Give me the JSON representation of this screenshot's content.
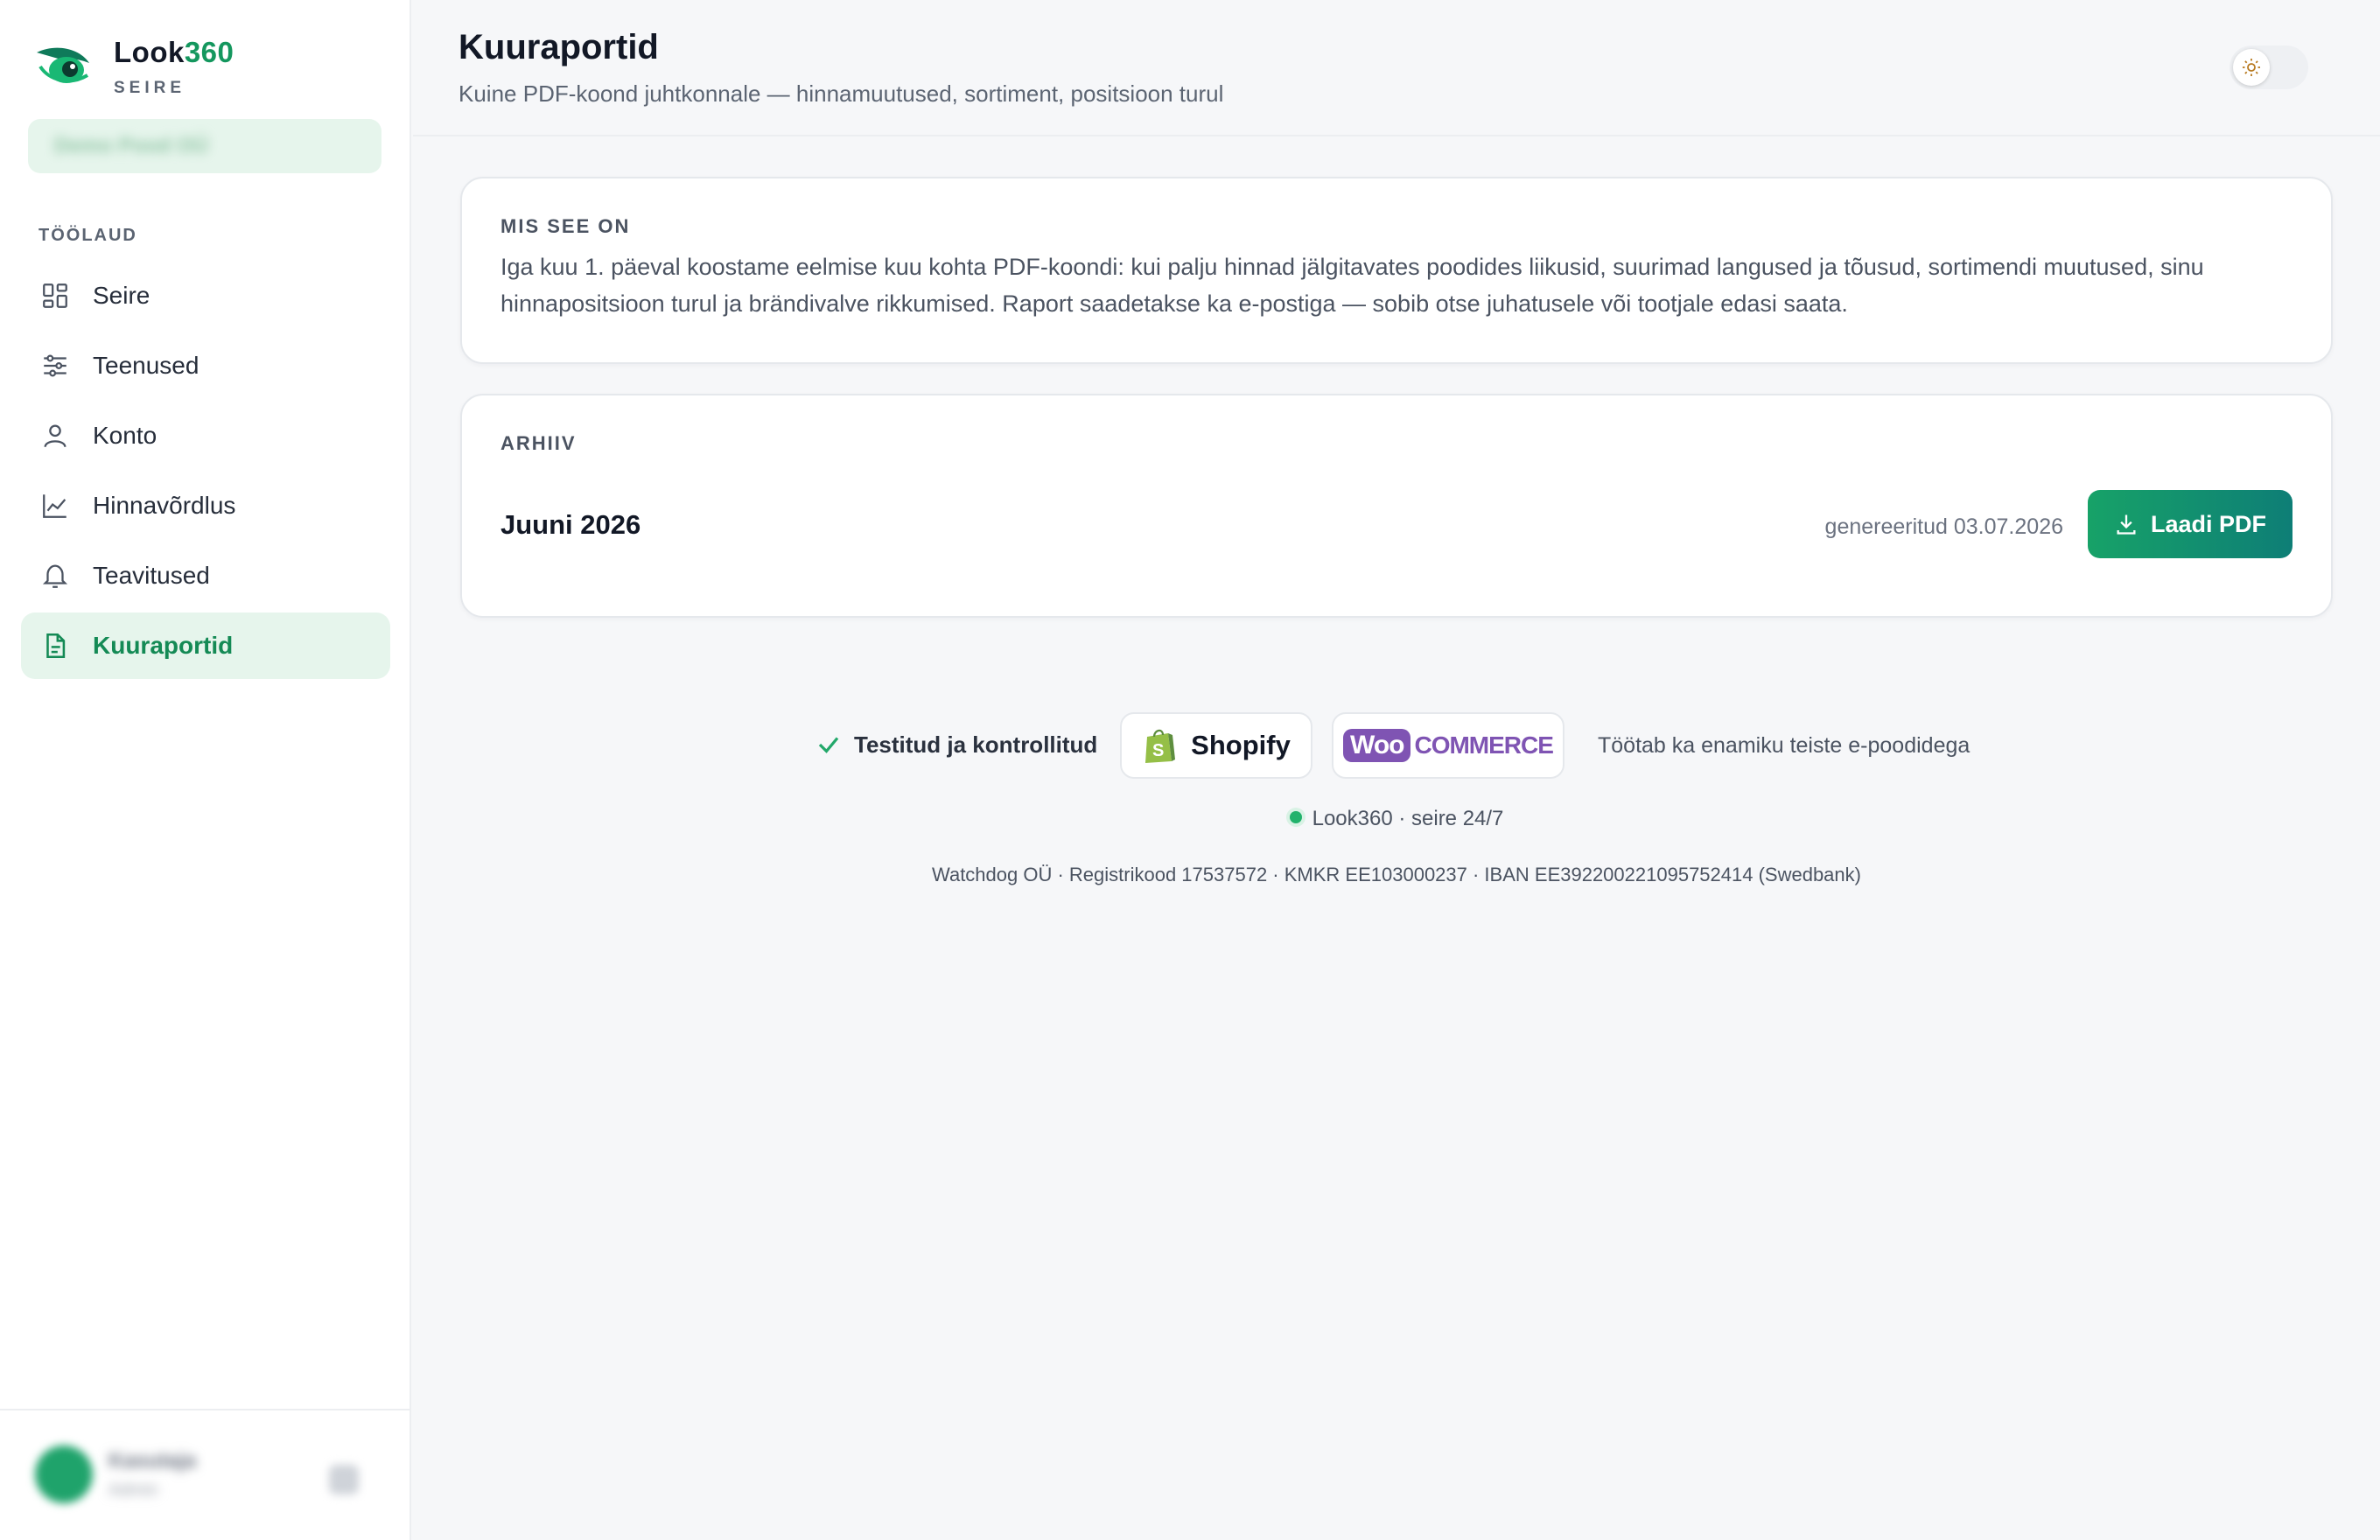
{
  "brand": {
    "name_part1": "Look",
    "name_part2": "360",
    "subtitle": "SEIRE",
    "store_name": "Demo Pood OÜ"
  },
  "sidebar": {
    "section_label": "TÖÖLAUD",
    "items": [
      {
        "label": "Seire",
        "icon": "grid-icon",
        "active": false
      },
      {
        "label": "Teenused",
        "icon": "sliders-icon",
        "active": false
      },
      {
        "label": "Konto",
        "icon": "user-icon",
        "active": false
      },
      {
        "label": "Hinnavõrdlus",
        "icon": "line-chart-icon",
        "active": false
      },
      {
        "label": "Teavitused",
        "icon": "bell-icon",
        "active": false
      },
      {
        "label": "Kuuraportid",
        "icon": "file-text-icon",
        "active": true
      }
    ],
    "user": {
      "name": "Kasutaja",
      "role": "Admin"
    }
  },
  "header": {
    "title": "Kuuraportid",
    "subtitle": "Kuine PDF-koond juhtkonnale — hinnamuutused, sortiment, positsioon turul"
  },
  "about": {
    "label": "MIS SEE ON",
    "text": "Iga kuu 1. päeval koostame eelmise kuu kohta PDF-koondi: kui palju hinnad jälgitavates poodides liikusid, suurimad langused ja tõusud, sortimendi muutused, sinu hinnapositsioon turul ja brändivalve rikkumised. Raport saadetakse ka e-postiga — sobib otse juhatusele või tootjale edasi saata."
  },
  "archive": {
    "label": "ARHIIV",
    "reports": [
      {
        "month": "Juuni 2026",
        "generated": "genereeritud 03.07.2026",
        "button": "Laadi PDF"
      }
    ]
  },
  "footer": {
    "trust_text": "Testitud ja kontrollitud",
    "shopify_label": "Shopify",
    "woo_mark": "Woo",
    "woo_word": "COMMERCE",
    "other_platforms": "Töötab ka enamiku teiste e-poodidega",
    "status": "Look360 · seire 24/7",
    "legal": "Watchdog OÜ · Registrikood 17537572 · KMKR EE103000237 · IBAN EE392200221095752414 (Swedbank)"
  },
  "colors": {
    "accent": "#14975e",
    "active_bg": "#e6f5ec",
    "button_start": "#17a268",
    "button_end": "#0e7e76"
  }
}
